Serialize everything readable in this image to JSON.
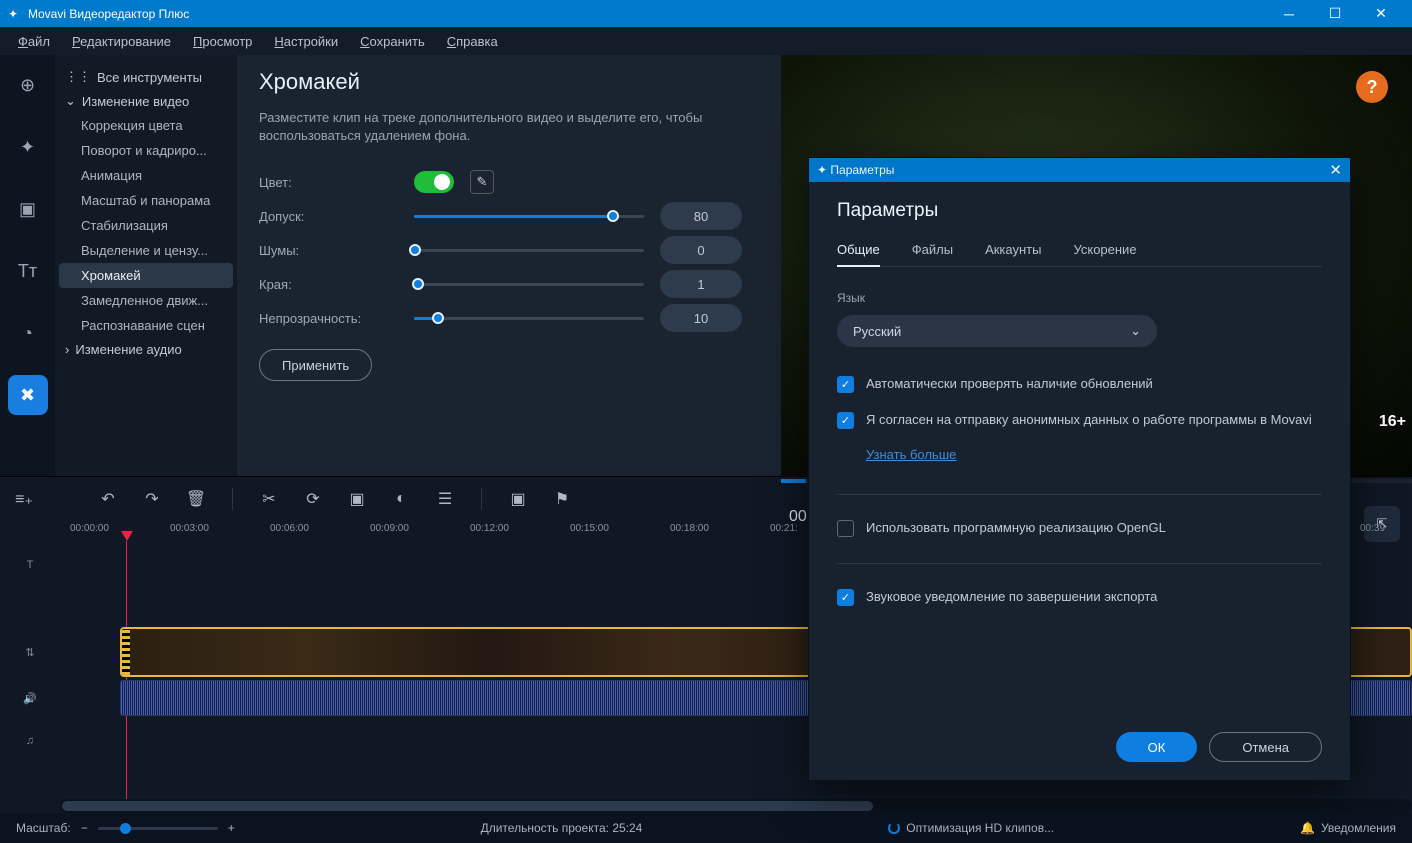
{
  "title": "Movavi Видеоредактор Плюс",
  "menu": [
    "Файл",
    "Редактирование",
    "Просмотр",
    "Настройки",
    "Сохранить",
    "Справка"
  ],
  "sidebar": {
    "all": "Все инструменты",
    "video_group": "Изменение видео",
    "items": [
      "Коррекция цвета",
      "Поворот и кадриро...",
      "Анимация",
      "Масштаб и панорама",
      "Стабилизация",
      "Выделение и цензу...",
      "Хромакей",
      "Замедленное движ...",
      "Распознавание сцен"
    ],
    "audio_group": "Изменение аудио"
  },
  "panel": {
    "heading": "Хромакей",
    "desc": "Разместите клип на треке дополнительного видео и выделите его, чтобы воспользоваться удалением фона.",
    "color": "Цвет:",
    "tolerance": {
      "label": "Допуск:",
      "value": "80",
      "pct": 86
    },
    "noise": {
      "label": "Шумы:",
      "value": "0",
      "pct": 0
    },
    "edges": {
      "label": "Края:",
      "value": "1",
      "pct": 1
    },
    "opacity": {
      "label": "Непрозрачность:",
      "value": "10",
      "pct": 10
    },
    "apply": "Применить"
  },
  "preview": {
    "time": "00:",
    "age": "16+"
  },
  "ruler": [
    "00:00:00",
    "00:03:00",
    "00:06:00",
    "00:09:00",
    "00:12:00",
    "00:15:00",
    "00:18:00",
    "00:21:",
    "00:39"
  ],
  "status": {
    "zoom": "Масштаб:",
    "duration_label": "Длительность проекта:",
    "duration_value": "25:24",
    "optimize": "Оптимизация HD клипов...",
    "notifications": "Уведомления"
  },
  "dialog": {
    "title": "Параметры",
    "heading": "Параметры",
    "tabs": [
      "Общие",
      "Файлы",
      "Аккаунты",
      "Ускорение"
    ],
    "lang_label": "Язык",
    "lang_value": "Русский",
    "check_updates": "Автоматически проверять наличие обновлений",
    "anon_data": "Я согласен на отправку анонимных данных о работе программы в Movavi",
    "learn_more": "Узнать больше",
    "opengl": "Использовать программную реализацию OpenGL",
    "sound_notify": "Звуковое уведомление по завершении экспорта",
    "ok": "ОК",
    "cancel": "Отмена"
  }
}
